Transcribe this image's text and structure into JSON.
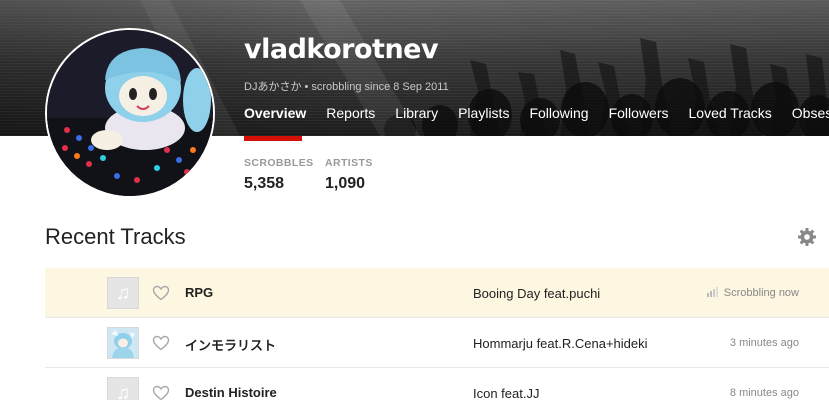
{
  "profile": {
    "username": "vladkorotnev",
    "display_name": "DJあかさか",
    "scrobbling_since": "scrobbling since 8 Sep 2011"
  },
  "nav": {
    "items": [
      {
        "label": "Overview",
        "active": true
      },
      {
        "label": "Reports"
      },
      {
        "label": "Library"
      },
      {
        "label": "Playlists"
      },
      {
        "label": "Following"
      },
      {
        "label": "Followers"
      },
      {
        "label": "Loved Tracks"
      },
      {
        "label": "Obsessions"
      }
    ]
  },
  "stats": {
    "scrobbles": {
      "label": "SCROBBLES",
      "value": "5,358"
    },
    "artists": {
      "label": "ARTISTS",
      "value": "1,090"
    }
  },
  "recent_tracks": {
    "title": "Recent Tracks",
    "tracks": [
      {
        "name": "RPG",
        "artist": "Booing Day feat.puchi",
        "time": "Scrobbling now",
        "now_playing": true
      },
      {
        "name": "インモラリスト",
        "artist": "Hommarju feat.R.Cena+hideki",
        "time": "3 minutes ago"
      },
      {
        "name": "Destin Histoire",
        "artist": "Icon feat.JJ",
        "time": "8 minutes ago"
      }
    ]
  },
  "colors": {
    "accent": "#d51007",
    "now_playing_bg": "#fdf6e0"
  },
  "icons": {
    "settings": "gear-icon",
    "love": "heart-icon",
    "placeholder_cover": "music-note-icon",
    "now_playing": "bars-icon"
  }
}
